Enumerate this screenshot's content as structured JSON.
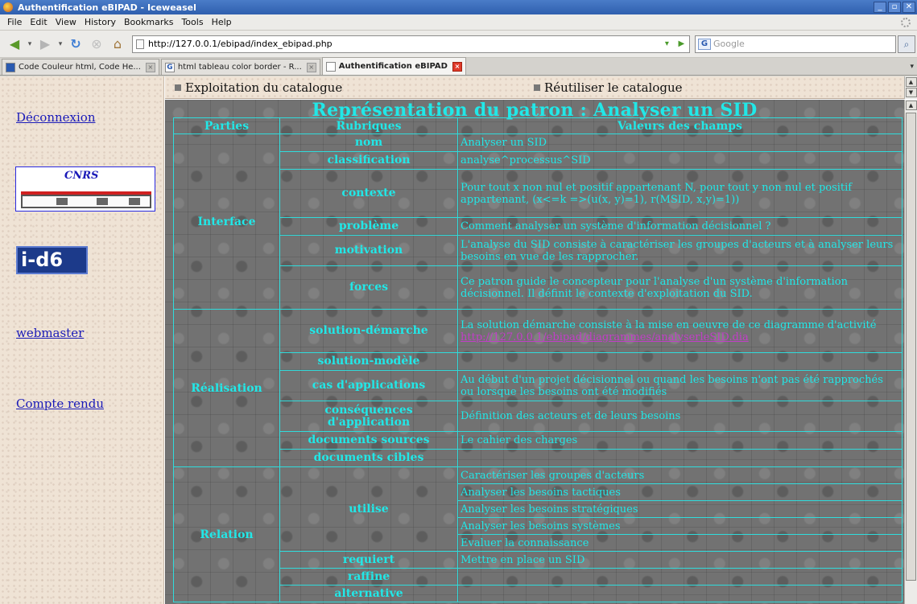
{
  "window": {
    "title": "Authentification eBIPAD - Iceweasel",
    "controls": [
      "_",
      "▫",
      "✕"
    ]
  },
  "menu": [
    "File",
    "Edit",
    "View",
    "History",
    "Bookmarks",
    "Tools",
    "Help"
  ],
  "navbar": {
    "url": "http://127.0.0.1/ebipad/index_ebipad.php",
    "search_placeholder": "Google",
    "search_engine": "G"
  },
  "tabs": [
    {
      "label": "Code Couleur html, Code He...",
      "favicon": "blue",
      "active": false
    },
    {
      "label": "html tableau color border - R...",
      "favicon": "G",
      "active": false
    },
    {
      "label": "Authentification eBIPAD",
      "favicon": "page",
      "active": true
    }
  ],
  "left": {
    "logout": "Déconnexion",
    "cnrs_logo_text": "CNRS",
    "id6_logo_text": "i-d6",
    "webmaster": "webmaster",
    "report": "Compte rendu"
  },
  "topnav": {
    "exploit": "Exploitation du catalogue",
    "reuse": "Réutiliser le catalogue"
  },
  "main": {
    "title": "Représentation du patron : Analyser un SID",
    "headers": [
      "Parties",
      "Rubriques",
      "Valeurs des champs"
    ],
    "parts": {
      "interface": "Interface",
      "realisation": "Réalisation",
      "relation": "Relation"
    },
    "rows": [
      {
        "rub": "nom",
        "val": "Analyser un SID"
      },
      {
        "rub": "classification",
        "val": "analyse^processus^SID"
      },
      {
        "rub": "contexte",
        "val": "Pour tout x non nul et positif appartenant N, pour tout y non nul et positif appartenant, (x<=k =>(u(x, y)=1), r(MSID, x,y)=1))"
      },
      {
        "rub": "problème",
        "val": "Comment analyser un système d'information décisionnel ?"
      },
      {
        "rub": "motivation",
        "val": "L'analyse du SID consiste à caractériser les groupes d'acteurs et à analyser leurs besoins en vue de les rapprocher."
      },
      {
        "rub": "forces",
        "val": "Ce patron guide le concepteur pour l'analyse d'un système d'information décisionnel. Il définit le contexte d'exploitation du SID."
      },
      {
        "rub": "solution-démarche",
        "val": "La solution démarche consiste à la mise en oeuvre de ce diagramme d'activité",
        "link": "http://127.0.0.1/ebipad/diagrammes/analyserleSID.dia"
      },
      {
        "rub": "solution-modèle",
        "val": ""
      },
      {
        "rub": "cas d'applications",
        "val": "Au début d'un projet décisionnel ou quand les besoins n'ont pas été rapprochés ou lorsque les besoins ont été modifiés"
      },
      {
        "rub": "conséquences d'application",
        "val": "Définition des acteurs et de leurs besoins"
      },
      {
        "rub": "documents sources",
        "val": "Le cahier des charges"
      },
      {
        "rub": "documents cibles",
        "val": ""
      },
      {
        "rub": "utilise",
        "vals": [
          "Caractériser les groupes d'acteurs",
          "Analyser les besoins tactiques",
          "Analyser les besoins stratégiques",
          "Analyser les besoins systèmes",
          "Evaluer la connaissance"
        ]
      },
      {
        "rub": "requiert",
        "val": "Mettre en place un SID"
      },
      {
        "rub": "raffine",
        "val": ""
      },
      {
        "rub": "alternative",
        "val": ""
      }
    ]
  }
}
